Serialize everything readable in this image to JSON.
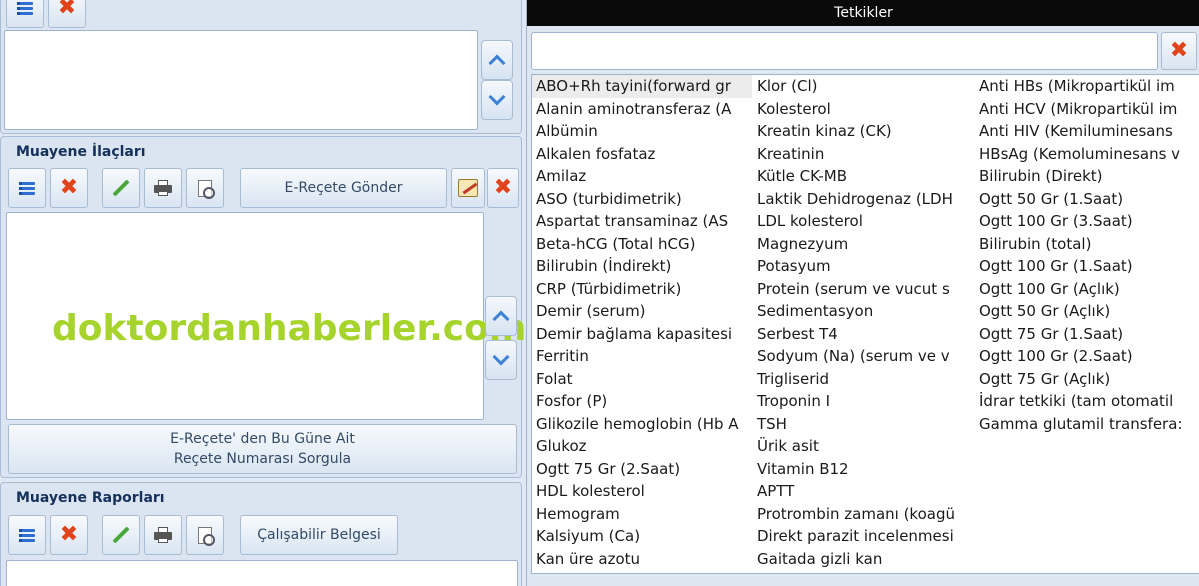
{
  "left": {
    "top_section": {},
    "muayene_ilaclari": {
      "title": "Muayene İlaçları",
      "erecete_button": "E-Reçete Gönder",
      "query_button_line1": "E-Reçete' den Bu Güne Ait",
      "query_button_line2": "Reçete Numarası Sorgula"
    },
    "muayene_raporlari": {
      "title": "Muayene Raporları",
      "calisabilir_button": "Çalışabilir Belgesi"
    },
    "watermark": "doktordanhaberler.com"
  },
  "tetkikler": {
    "title": "Tetkikler",
    "search_value": "",
    "columns": [
      [
        "ABO+Rh tayini(forward gr",
        "Alanin aminotransferaz (A",
        "Albümin",
        "Alkalen fosfataz",
        "Amilaz",
        "ASO (turbidimetrik)",
        "Aspartat transaminaz (AS",
        "Beta-hCG (Total hCG)",
        "Bilirubin (İndirekt)",
        "CRP (Türbidimetrik)",
        "Demir (serum)",
        "Demir bağlama kapasitesi",
        "Ferritin",
        "Folat",
        "Fosfor (P)",
        "Glikozile hemoglobin (Hb A",
        "Glukoz",
        "Ogtt 75 Gr (2.Saat)",
        "HDL kolesterol",
        "Hemogram",
        "Kalsiyum (Ca)",
        "Kan üre azotu"
      ],
      [
        "Klor (Cl)",
        "Kolesterol",
        "Kreatin kinaz (CK)",
        "Kreatinin",
        "Kütle CK-MB",
        "Laktik Dehidrogenaz (LDH",
        "LDL kolesterol",
        "Magnezyum",
        "Potasyum",
        "Protein (serum ve vucut s",
        "Sedimentasyon",
        "Serbest T4",
        "Sodyum  (Na) (serum ve v",
        "Trigliserid",
        "Troponin I",
        "TSH",
        "Ürik asit",
        "Vitamin B12",
        "APTT",
        "Protrombin zamanı (koagü",
        "Direkt parazit incelenmesi",
        "Gaitada gizli kan"
      ],
      [
        "Anti HBs  (Mikropartikül im",
        "Anti HCV (Mikropartikül im",
        "Anti HIV (Kemiluminesans",
        "HBsAg (Kemoluminesans v",
        "Bilirubin (Direkt)",
        "Ogtt 50 Gr (1.Saat)",
        "Ogtt 100 Gr (3.Saat)",
        "Bilirubin (total)",
        "Ogtt 100 Gr (1.Saat)",
        "Ogtt 100 Gr (Açlık)",
        "Ogtt 50 Gr (Açlık)",
        "Ogtt 75 Gr (1.Saat)",
        "Ogtt 100 Gr (2.Saat)",
        "Ogtt 75 Gr (Açlık)",
        "İdrar tetkiki (tam otomatil",
        "Gamma glutamil transfera:"
      ]
    ]
  }
}
